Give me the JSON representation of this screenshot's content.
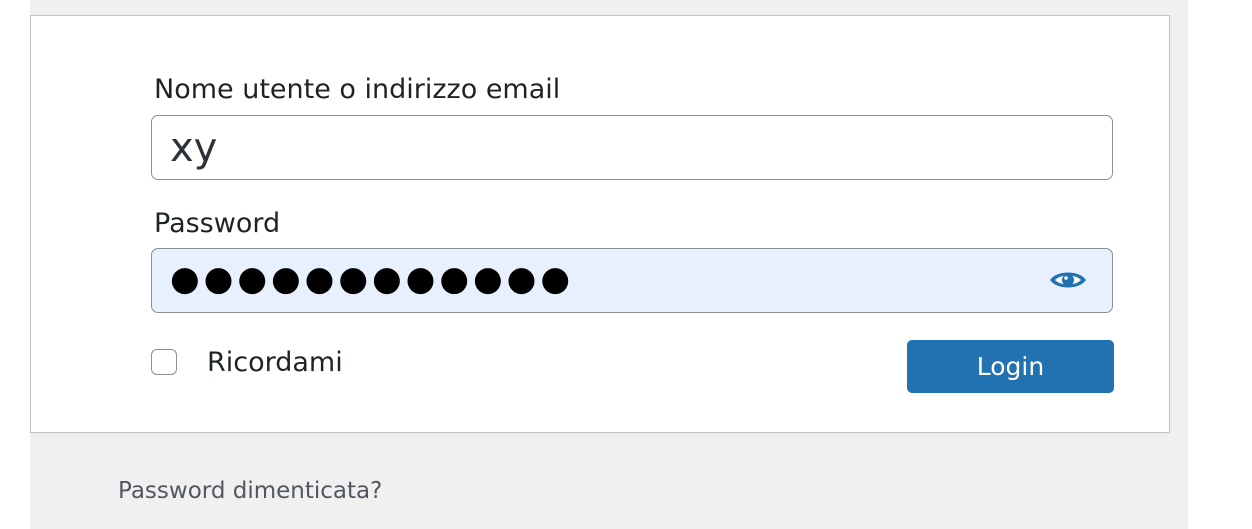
{
  "login_form": {
    "username_label": "Nome utente o indirizzo email",
    "username_value": "xy",
    "password_label": "Password",
    "password_masked": "●●●●●●●●●●●●",
    "show_password_icon": "eye-icon",
    "remember_label": "Ricordami",
    "remember_checked": false,
    "submit_label": "Login"
  },
  "footer": {
    "forgot_password_link": "Password dimenticata?"
  },
  "colors": {
    "accent": "#2271b1",
    "autofill_background": "#e8f0fe",
    "page_background": "#f0f0f1"
  }
}
